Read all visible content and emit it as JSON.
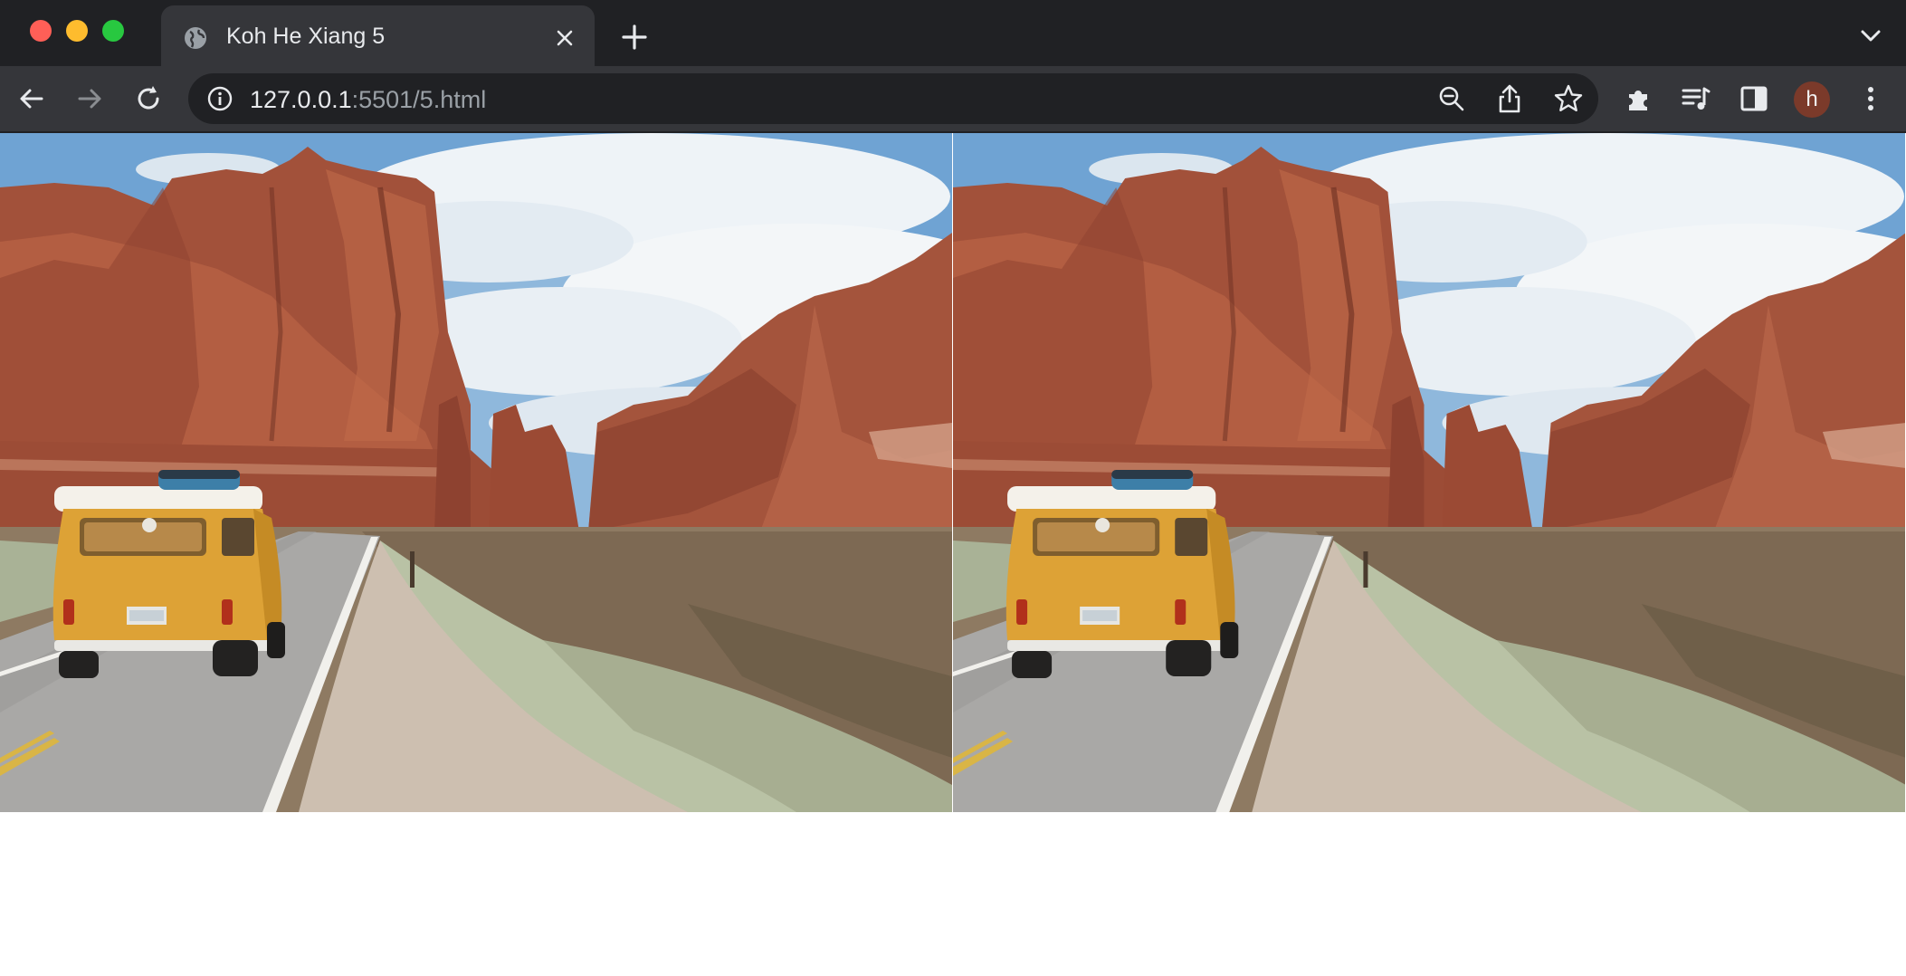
{
  "window": {
    "traffic_lights": [
      "close",
      "minimize",
      "zoom"
    ]
  },
  "tab": {
    "title": "Koh He Xiang 5",
    "favicon": "globe-icon"
  },
  "toolbar": {
    "url_host": "127.0.0.1",
    "url_path": ":5501/5.html",
    "profile_initial": "h"
  },
  "page": {
    "images": [
      {
        "name": "desert-road-van-photo-1",
        "subject": "yellow van on desert road with red rock formations"
      },
      {
        "name": "desert-road-van-photo-2",
        "subject": "yellow van on desert road with red rock formations"
      }
    ]
  },
  "colors": {
    "tabstrip": "#202124",
    "toolbar": "#35363a",
    "active_tab": "#35363a"
  }
}
